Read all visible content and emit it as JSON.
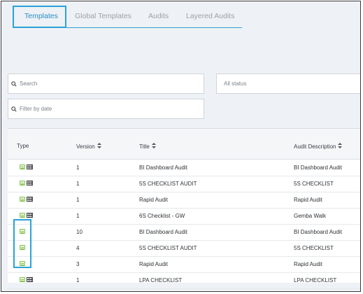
{
  "tabs": [
    "Templates",
    "Global Templates",
    "Audits",
    "Layered Audits"
  ],
  "active_tab": "Templates",
  "filters": {
    "search_placeholder": "Search",
    "status_label": "All status",
    "date_placeholder": "Filter by date"
  },
  "table": {
    "columns": [
      "Type",
      "Version",
      "Title",
      "Audit Description"
    ],
    "rows": [
      {
        "icons": [
          "document-icon",
          "grid-icon"
        ],
        "version": "1",
        "title": "BI Dashboard Audit",
        "description": "BI Dashboard Audit"
      },
      {
        "icons": [
          "document-icon",
          "grid-icon"
        ],
        "version": "1",
        "title": "5S CHECKLIST AUDIT",
        "description": "5S CHECKLIST"
      },
      {
        "icons": [
          "document-icon",
          "grid-icon"
        ],
        "version": "1",
        "title": "Rapid Audit",
        "description": "Rapid Audit"
      },
      {
        "icons": [
          "document-icon",
          "grid-icon"
        ],
        "version": "1",
        "title": "6S Checklist - GW",
        "description": "Gemba Walk"
      },
      {
        "icons": [
          "document-icon"
        ],
        "version": "10",
        "title": "BI Dashboard Audit",
        "description": "BI Dashboard Audit"
      },
      {
        "icons": [
          "document-icon"
        ],
        "version": "4",
        "title": "5S CHECKLIST AUDIT",
        "description": "5S CHECKLIST"
      },
      {
        "icons": [
          "document-icon"
        ],
        "version": "3",
        "title": "Rapid Audit",
        "description": "Rapid Audit"
      },
      {
        "icons": [
          "document-icon",
          "grid-icon"
        ],
        "version": "1",
        "title": "LPA CHECKLIST",
        "description": "LPA CHECKLIST"
      }
    ]
  },
  "colors": {
    "accent": "#2a8fc4",
    "highlight": "#29a3d8",
    "doc_icon": "#7fc04c"
  }
}
